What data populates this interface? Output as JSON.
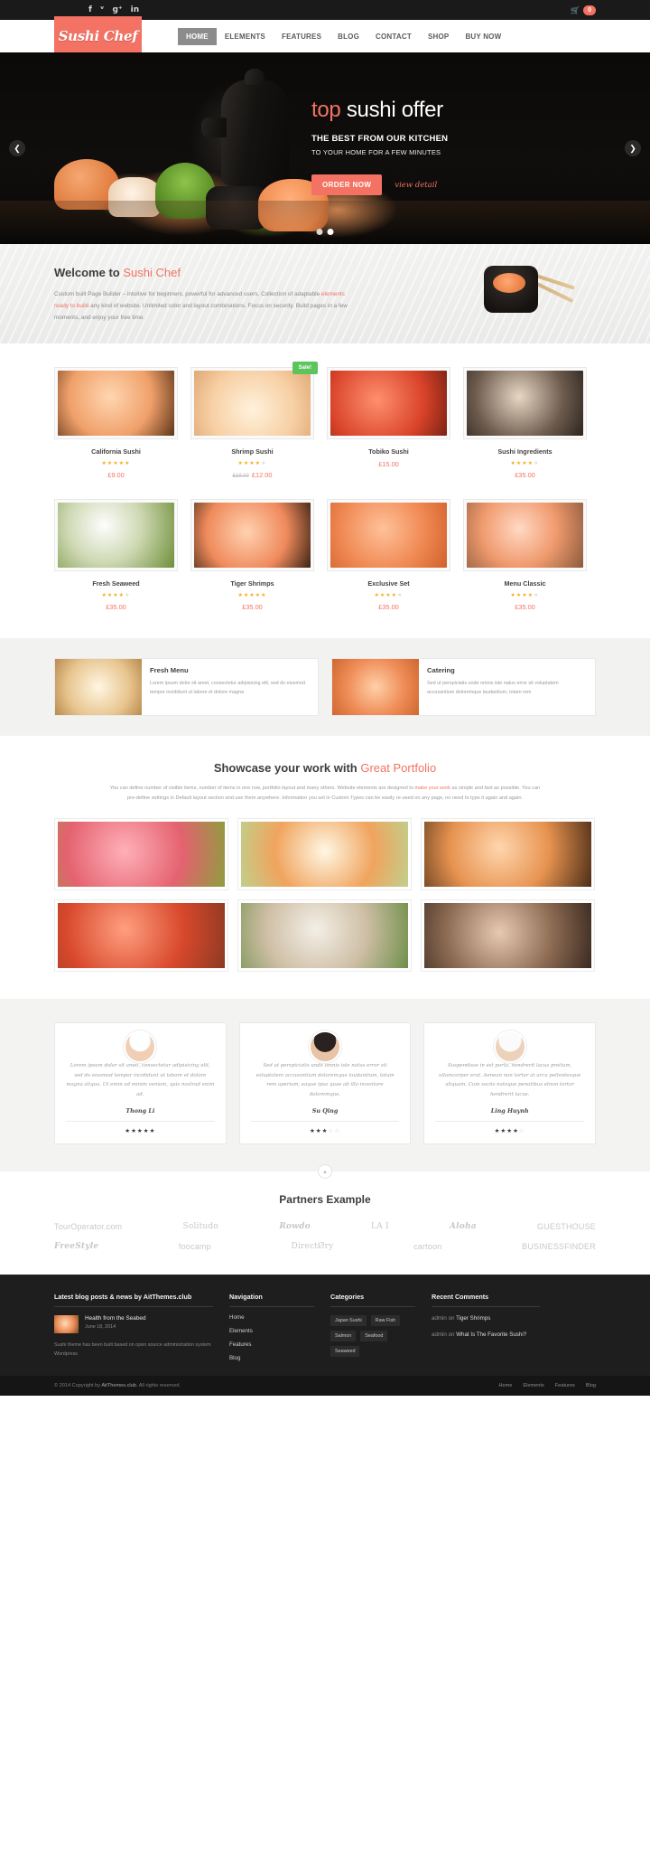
{
  "topbar": {
    "social": [
      {
        "name": "facebook-icon",
        "glyph": "f"
      },
      {
        "name": "twitter-icon",
        "glyph": "ᵛ"
      },
      {
        "name": "googleplus-icon",
        "glyph": "g⁺"
      },
      {
        "name": "linkedin-icon",
        "glyph": "in"
      }
    ],
    "cart_icon": "cart-icon",
    "cart_count": "0"
  },
  "header": {
    "logo": "Sushi Chef",
    "nav": [
      {
        "label": "HOME",
        "active": true
      },
      {
        "label": "ELEMENTS",
        "active": false
      },
      {
        "label": "FEATURES",
        "active": false
      },
      {
        "label": "BLOG",
        "active": false
      },
      {
        "label": "CONTACT",
        "active": false
      },
      {
        "label": "SHOP",
        "active": false
      },
      {
        "label": "BUY NOW",
        "active": false
      }
    ]
  },
  "hero": {
    "title_accent": "top",
    "title_rest": " sushi offer",
    "subtitle1": "THE BEST FROM OUR KITCHEN",
    "subtitle2": "TO YOUR HOME FOR A FEW MINUTES",
    "cta_primary": "ORDER NOW",
    "cta_secondary": "view detail",
    "prev_icon": "chevron-left-icon",
    "next_icon": "chevron-right-icon",
    "slides": 2,
    "active_slide": 2
  },
  "welcome": {
    "heading_plain": "Welcome to ",
    "heading_accent": "Sushi Chef",
    "text_1": "Custom built Page Builder – intuitive for beginners, powerful for advanced users. Collection of adaptable ",
    "text_link": "elements ready to build",
    "text_2": " any kind of website. Unlimited color and layout combinations. Focus on security. Build pages in a few moments, and enjoy your free time."
  },
  "products": {
    "row1": [
      {
        "name": "California Sushi",
        "price": "£9.00",
        "old_price": "",
        "stars": 5,
        "sale": false,
        "img": "img-cali"
      },
      {
        "name": "Shrimp Sushi",
        "price": "£12.00",
        "old_price": "£19.00",
        "stars": 4,
        "sale": true,
        "sale_label": "Sale!",
        "img": "img-shrimp"
      },
      {
        "name": "Tobiko Sushi",
        "price": "£15.00",
        "old_price": "",
        "stars": 0,
        "sale": false,
        "img": "img-tobiko"
      },
      {
        "name": "Sushi Ingredients",
        "price": "£35.00",
        "old_price": "",
        "stars": 4,
        "sale": false,
        "img": "img-ingred"
      }
    ],
    "row2": [
      {
        "name": "Fresh Seaweed",
        "price": "£35.00",
        "old_price": "",
        "stars": 4,
        "sale": false,
        "img": "img-seaweed"
      },
      {
        "name": "Tiger Shrimps",
        "price": "£35.00",
        "old_price": "",
        "stars": 5,
        "sale": false,
        "img": "img-tiger"
      },
      {
        "name": "Exclusive Set",
        "price": "£35.00",
        "old_price": "",
        "stars": 4,
        "sale": false,
        "img": "img-exclusive"
      },
      {
        "name": "Menu Classic",
        "price": "£35.00",
        "old_price": "",
        "stars": 4,
        "sale": false,
        "img": "img-classic"
      }
    ]
  },
  "feature_boxes": [
    {
      "title": "Fresh Menu",
      "text": "Lorem ipsum dolor sit amet, consectetur adipisicing elit, sed do eiusmod tempor incididunt ut labore et dolore magna"
    },
    {
      "title": "Catering",
      "text": "Sed ut perspiciatis unde omnis iste natus error sit voluptatem accusantium doloremque laudantium, totam rem"
    }
  ],
  "portfolio": {
    "title_plain": "Showcase your work with ",
    "title_accent": "Great Portfolio",
    "desc_1": "You can define number of visible items, number of items in one row, portfolio layout and many others. Website elements are designed to ",
    "desc_link": "make your work",
    "desc_2": " as simple and fast as possible. You can pre-define settings in Default layout section and use them anywhere. Information you set in Custom Types can be easily re-used on any page, no need to type it again and again.",
    "items": [
      "pfi-1",
      "pfi-2",
      "pfi-3",
      "pfi-4",
      "pfi-5",
      "pfi-6"
    ]
  },
  "testimonials": [
    {
      "text": "Lorem ipsum dolor sit amet, consectetur adipisicing elit, sed do eiusmod tempor incididunt ut labore et dolore magna aliqua. Ut enim ad minim veniam, quis nostrud enim ad.",
      "name": "Thong Li",
      "stars": 5,
      "avatar": "av-1"
    },
    {
      "text": "Sed ut perspiciatis unde omnis iste natus error sit voluptatem accusantium doloremque laudantium, totam rem aperiam, eaque ipsa quae ab illo inventore doloremque.",
      "name": "Su Qing",
      "stars": 3,
      "avatar": "av-2"
    },
    {
      "text": "Suspendisse in est porta, hendrerit lacus pretium, ullamcorper erat. Aenean non tortor at arcu pellentesque aliquam. Cum sociis natoque penatibus etnon tortor hendrerit lacus.",
      "name": "Ling Huynh",
      "stars": 4,
      "avatar": "av-3"
    }
  ],
  "partners": {
    "title": "Partners Example",
    "scroll_top_icon": "scroll-top-icon",
    "row1": [
      "TourOperator.com",
      "Solitudo",
      "Rowdo",
      "LA I",
      "Aloha",
      "GUESTHOUSE"
    ],
    "row2": [
      "FreeStyle",
      "foocamp",
      "DirectØry",
      "cartoon",
      "BUSINESSFINDER"
    ]
  },
  "footer": {
    "col1": {
      "heading": "Latest blog posts & news by AitThemes.club",
      "post_title": "Health from the Seabed",
      "post_date": "June 18, 2014",
      "note": "Sushi theme has been built based on open source administration system Wordpress"
    },
    "col2": {
      "heading": "Navigation",
      "links": [
        "Home",
        "Elements",
        "Features",
        "Blog"
      ]
    },
    "col3": {
      "heading": "Categories",
      "tags": [
        "Japan Sushi",
        "Raw Fish",
        "Salmon",
        "Seafood",
        "Seaweed"
      ]
    },
    "col4": {
      "heading": "Recent Comments",
      "comments": [
        {
          "prefix": "admin on ",
          "link": "Tiger Shrimps"
        },
        {
          "prefix": "admin on ",
          "link": "What Is The Favorite Sushi?"
        }
      ]
    }
  },
  "bottombar": {
    "copyright_pre": "© 2014 Copyright by ",
    "copyright_link": "AitThemes.club",
    "copyright_post": ". All rights reserved.",
    "nav": [
      "Home",
      "Elements",
      "Features",
      "Blog"
    ]
  },
  "colors": {
    "accent": "#f37263",
    "sale_green": "#5bc45b",
    "star_gold": "#f2b01e",
    "dark": "#1a1a1a"
  }
}
